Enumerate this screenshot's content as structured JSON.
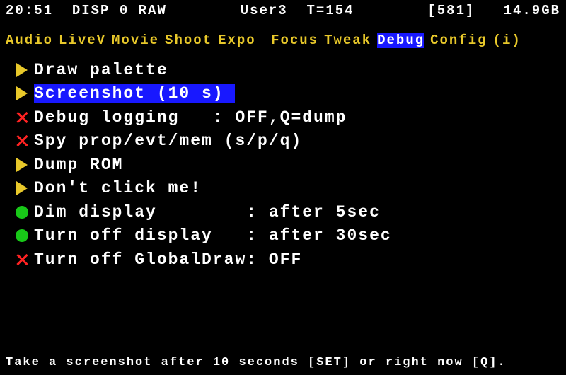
{
  "status": {
    "time": "20:51",
    "disp": "DISP 0 RAW",
    "user": "User3",
    "t": "T=154",
    "num": "[581]",
    "free": "14.9GB"
  },
  "tabs": [
    {
      "label": "Audio"
    },
    {
      "label": "LiveV"
    },
    {
      "label": "Movie"
    },
    {
      "label": "Shoot"
    },
    {
      "label": "Expo "
    },
    {
      "label": "Focus"
    },
    {
      "label": "Tweak"
    },
    {
      "label": "Debug",
      "selected": true
    },
    {
      "label": "Config"
    },
    {
      "label": "(i)"
    }
  ],
  "menu": [
    {
      "icon": "tri",
      "label": "Draw palette"
    },
    {
      "icon": "tri",
      "label": "Screenshot (10 s) ",
      "selected": true
    },
    {
      "icon": "x",
      "label": "Debug logging   : OFF,Q=dump"
    },
    {
      "icon": "x",
      "label": "Spy prop/evt/mem (s/p/q)"
    },
    {
      "icon": "tri",
      "label": "Dump ROM"
    },
    {
      "icon": "tri",
      "label": "Don't click me!"
    },
    {
      "icon": "dot",
      "label": "Dim display        : after 5sec"
    },
    {
      "icon": "dot",
      "label": "Turn off display   : after 30sec"
    },
    {
      "icon": "x",
      "label": "Turn off GlobalDraw: OFF"
    }
  ],
  "footer": "Take a screenshot after 10 seconds [SET] or right now [Q]."
}
